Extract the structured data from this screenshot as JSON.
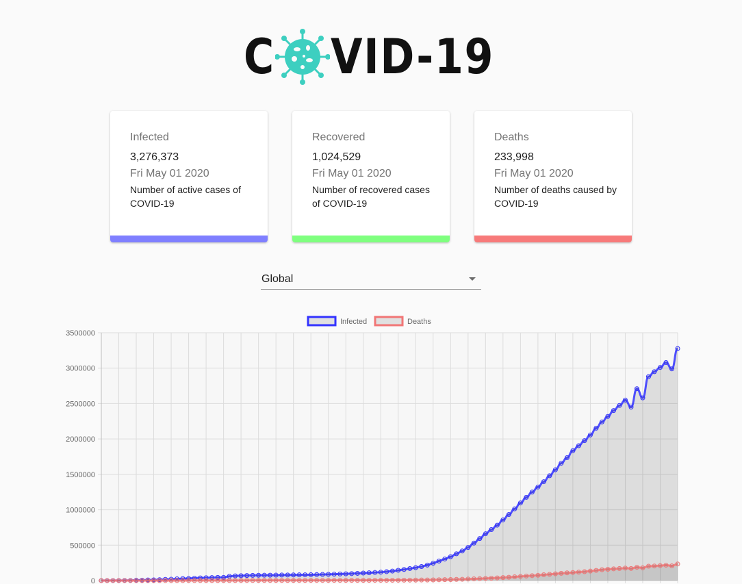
{
  "header": {
    "logo_left": "C",
    "logo_right": "VID-19",
    "logo_icon": "virus-icon",
    "logo_color": "#3dcfc0"
  },
  "cards": [
    {
      "title": "Infected",
      "count": "3,276,373",
      "date": "Fri May 01 2020",
      "description": "Number of active cases of COVID-19",
      "color": "#7f7fff"
    },
    {
      "title": "Recovered",
      "count": "1,024,529",
      "date": "Fri May 01 2020",
      "description": "Number of recovered cases of COVID-19",
      "color": "#7fff7f"
    },
    {
      "title": "Deaths",
      "count": "233,998",
      "date": "Fri May 01 2020",
      "description": "Number of deaths caused by COVID-19",
      "color": "#f77a7a"
    }
  ],
  "country_select": {
    "value": "Global",
    "icon": "dropdown-arrow-icon"
  },
  "chart_data": {
    "type": "line",
    "title": "",
    "xlabel": "",
    "ylabel": "",
    "ylim": [
      0,
      3500000
    ],
    "y_ticks": [
      "3500000",
      "3000000",
      "2500000",
      "2000000",
      "1500000",
      "1000000",
      "500000",
      "0"
    ],
    "grid": true,
    "legend": "top-center",
    "series": [
      {
        "name": "Infected",
        "color": "#3333ff",
        "fill": "rgba(0,0,0,0.1)",
        "values": [
          555,
          654,
          941,
          1434,
          2118,
          2927,
          5578,
          6166,
          8234,
          9927,
          12038,
          16787,
          19881,
          23892,
          27635,
          30794,
          34391,
          37120,
          40150,
          42762,
          44802,
          45221,
          60368,
          66885,
          69030,
          71224,
          73258,
          75136,
          75639,
          76197,
          76819,
          78572,
          78958,
          79561,
          80406,
          81388,
          82746,
          84112,
          86604,
          88585,
          90443,
          93016,
          95314,
          98425,
          102050,
          106099,
          109991,
          114381,
          118948,
          126214,
          134576,
          145483,
          156653,
          169593,
          182490,
          198238,
          218822,
          244933,
          275597,
          305036,
          336953,
          378235,
          418045,
          467653,
          529591,
          593291,
          660706,
          720117,
          782365,
          857487,
          932605,
          1013157,
          1095917,
          1176060,
          1249754,
          1321481,
          1396476,
          1480200,
          1565278,
          1657526,
          1735650,
          1834721,
          1904838,
          1976191,
          2056054,
          2152437,
          2240190,
          2317759,
          2401379,
          2472259,
          2549123,
          2450000,
          2710000,
          2580000,
          2880000,
          2950000,
          3010000,
          3080000,
          2990000,
          3276373
        ]
      },
      {
        "name": "Deaths",
        "color": "#f17676",
        "fill": "rgba(0,0,0,0.1)",
        "values": [
          17,
          18,
          26,
          42,
          56,
          82,
          131,
          133,
          171,
          213,
          259,
          362,
          426,
          492,
          564,
          634,
          719,
          806,
          906,
          1013,
          1113,
          1118,
          1371,
          1523,
          1666,
          1770,
          1868,
          2007,
          2122,
          2247,
          2251,
          2458,
          2469,
          2629,
          2708,
          2770,
          2814,
          2872,
          2941,
          2996,
          3085,
          3160,
          3254,
          3348,
          3460,
          3558,
          3802,
          3988,
          4262,
          4615,
          4720,
          5404,
          5819,
          6440,
          7126,
          7905,
          8733,
          9867,
          11299,
          12973,
          14623,
          16497,
          18615,
          21181,
          23970,
          27198,
          30652,
          33925,
          37582,
          42107,
          46809,
          52983,
          58787,
          64606,
          69374,
          74565,
          81865,
          88338,
          95455,
          102525,
          108503,
          114091,
          119482,
          125984,
          134177,
          143800,
          153822,
          159510,
          165044,
          169986,
          176583,
          171000,
          187705,
          180000,
          203000,
          206000,
          211000,
          217000,
          208000,
          233998
        ]
      }
    ]
  }
}
